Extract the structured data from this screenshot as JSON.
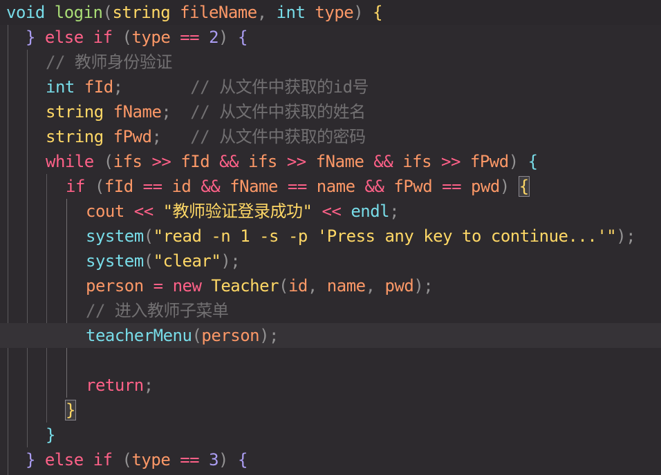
{
  "editor": {
    "theme": "dark",
    "colors": {
      "background": "#2d2a2e",
      "current_line": "#363337",
      "keyword": "#ff6188",
      "type": "#78dce8",
      "function": "#a9dc76",
      "string": "#ffd866",
      "parameter": "#fc9867",
      "number": "#ab9df2",
      "comment": "#727072"
    },
    "lines": [
      {
        "tokens": [
          {
            "t": "void",
            "c": "ty"
          },
          {
            "t": " ",
            "c": "va"
          },
          {
            "t": "login",
            "c": "fn"
          },
          {
            "t": "(",
            "c": "pu"
          },
          {
            "t": "string",
            "c": "tp"
          },
          {
            "t": " ",
            "c": "va"
          },
          {
            "t": "fileName",
            "c": "pa"
          },
          {
            "t": ", ",
            "c": "pu"
          },
          {
            "t": "int",
            "c": "ty"
          },
          {
            "t": " ",
            "c": "va"
          },
          {
            "t": "type",
            "c": "pa"
          },
          {
            "t": ") ",
            "c": "pu"
          },
          {
            "t": "{",
            "c": "br1"
          }
        ]
      },
      {
        "tokens": [
          {
            "t": "} ",
            "c": "br2"
          },
          {
            "t": "else",
            "c": "kw"
          },
          {
            "t": " ",
            "c": "va"
          },
          {
            "t": "if",
            "c": "kw"
          },
          {
            "t": " (",
            "c": "pu"
          },
          {
            "t": "type",
            "c": "pa"
          },
          {
            "t": " ",
            "c": "va"
          },
          {
            "t": "==",
            "c": "op"
          },
          {
            "t": " ",
            "c": "va"
          },
          {
            "t": "2",
            "c": "nu"
          },
          {
            "t": ") ",
            "c": "pu"
          },
          {
            "t": "{",
            "c": "br2"
          }
        ]
      },
      {
        "tokens": [
          {
            "t": "// 教师身份验证",
            "c": "cm"
          }
        ]
      },
      {
        "tokens": [
          {
            "t": "int",
            "c": "ty"
          },
          {
            "t": " ",
            "c": "va"
          },
          {
            "t": "fId",
            "c": "pa"
          },
          {
            "t": ";",
            "c": "pu"
          },
          {
            "t": "       ",
            "c": "va"
          },
          {
            "t": "// 从文件中获取的id号",
            "c": "cm"
          }
        ]
      },
      {
        "tokens": [
          {
            "t": "string",
            "c": "tp"
          },
          {
            "t": " ",
            "c": "va"
          },
          {
            "t": "fName",
            "c": "pa"
          },
          {
            "t": ";",
            "c": "pu"
          },
          {
            "t": "  ",
            "c": "va"
          },
          {
            "t": "// 从文件中获取的姓名",
            "c": "cm"
          }
        ]
      },
      {
        "tokens": [
          {
            "t": "string",
            "c": "tp"
          },
          {
            "t": " ",
            "c": "va"
          },
          {
            "t": "fPwd",
            "c": "pa"
          },
          {
            "t": ";",
            "c": "pu"
          },
          {
            "t": "   ",
            "c": "va"
          },
          {
            "t": "// 从文件中获取的密码",
            "c": "cm"
          }
        ]
      },
      {
        "tokens": [
          {
            "t": "while",
            "c": "kw"
          },
          {
            "t": " (",
            "c": "pu"
          },
          {
            "t": "ifs",
            "c": "pa"
          },
          {
            "t": " ",
            "c": "va"
          },
          {
            "t": ">>",
            "c": "op"
          },
          {
            "t": " ",
            "c": "va"
          },
          {
            "t": "fId",
            "c": "pa"
          },
          {
            "t": " ",
            "c": "va"
          },
          {
            "t": "&&",
            "c": "op"
          },
          {
            "t": " ",
            "c": "va"
          },
          {
            "t": "ifs",
            "c": "pa"
          },
          {
            "t": " ",
            "c": "va"
          },
          {
            "t": ">>",
            "c": "op"
          },
          {
            "t": " ",
            "c": "va"
          },
          {
            "t": "fName",
            "c": "pa"
          },
          {
            "t": " ",
            "c": "va"
          },
          {
            "t": "&&",
            "c": "op"
          },
          {
            "t": " ",
            "c": "va"
          },
          {
            "t": "ifs",
            "c": "pa"
          },
          {
            "t": " ",
            "c": "va"
          },
          {
            "t": ">>",
            "c": "op"
          },
          {
            "t": " ",
            "c": "va"
          },
          {
            "t": "fPwd",
            "c": "pa"
          },
          {
            "t": ") ",
            "c": "pu"
          },
          {
            "t": "{",
            "c": "br3"
          }
        ]
      },
      {
        "tokens": [
          {
            "t": "if",
            "c": "kw"
          },
          {
            "t": " (",
            "c": "pu"
          },
          {
            "t": "fId",
            "c": "pa"
          },
          {
            "t": " ",
            "c": "va"
          },
          {
            "t": "==",
            "c": "op"
          },
          {
            "t": " ",
            "c": "va"
          },
          {
            "t": "id",
            "c": "pa"
          },
          {
            "t": " ",
            "c": "va"
          },
          {
            "t": "&&",
            "c": "op"
          },
          {
            "t": " ",
            "c": "va"
          },
          {
            "t": "fName",
            "c": "pa"
          },
          {
            "t": " ",
            "c": "va"
          },
          {
            "t": "==",
            "c": "op"
          },
          {
            "t": " ",
            "c": "va"
          },
          {
            "t": "name",
            "c": "pa"
          },
          {
            "t": " ",
            "c": "va"
          },
          {
            "t": "&&",
            "c": "op"
          },
          {
            "t": " ",
            "c": "va"
          },
          {
            "t": "fPwd",
            "c": "pa"
          },
          {
            "t": " ",
            "c": "va"
          },
          {
            "t": "==",
            "c": "op"
          },
          {
            "t": " ",
            "c": "va"
          },
          {
            "t": "pwd",
            "c": "pa"
          },
          {
            "t": ") ",
            "c": "pu"
          },
          {
            "t": "{",
            "c": "br1",
            "match": true
          }
        ]
      },
      {
        "tokens": [
          {
            "t": "cout",
            "c": "pa"
          },
          {
            "t": " ",
            "c": "va"
          },
          {
            "t": "<<",
            "c": "op"
          },
          {
            "t": " ",
            "c": "va"
          },
          {
            "t": "\"教师验证登录成功\"",
            "c": "st"
          },
          {
            "t": " ",
            "c": "va"
          },
          {
            "t": "<<",
            "c": "op"
          },
          {
            "t": " ",
            "c": "va"
          },
          {
            "t": "endl",
            "c": "ty"
          },
          {
            "t": ";",
            "c": "pu"
          }
        ]
      },
      {
        "tokens": [
          {
            "t": "system",
            "c": "ty"
          },
          {
            "t": "(",
            "c": "pu"
          },
          {
            "t": "\"read -n 1 -s -p 'Press any key to continue...'\"",
            "c": "st"
          },
          {
            "t": ");",
            "c": "pu"
          }
        ]
      },
      {
        "tokens": [
          {
            "t": "system",
            "c": "ty"
          },
          {
            "t": "(",
            "c": "pu"
          },
          {
            "t": "\"clear\"",
            "c": "st"
          },
          {
            "t": ");",
            "c": "pu"
          }
        ]
      },
      {
        "tokens": [
          {
            "t": "person",
            "c": "pa"
          },
          {
            "t": " ",
            "c": "va"
          },
          {
            "t": "=",
            "c": "op"
          },
          {
            "t": " ",
            "c": "va"
          },
          {
            "t": "new",
            "c": "kw"
          },
          {
            "t": " ",
            "c": "va"
          },
          {
            "t": "Teacher",
            "c": "tp"
          },
          {
            "t": "(",
            "c": "pu"
          },
          {
            "t": "id",
            "c": "pa"
          },
          {
            "t": ", ",
            "c": "pu"
          },
          {
            "t": "name",
            "c": "pa"
          },
          {
            "t": ", ",
            "c": "pu"
          },
          {
            "t": "pwd",
            "c": "pa"
          },
          {
            "t": ");",
            "c": "pu"
          }
        ]
      },
      {
        "tokens": [
          {
            "t": "// 进入教师子菜单",
            "c": "cm"
          }
        ]
      },
      {
        "tokens": [
          {
            "t": "teacherMenu",
            "c": "ty"
          },
          {
            "t": "(",
            "c": "pu"
          },
          {
            "t": "person",
            "c": "pa"
          },
          {
            "t": ");",
            "c": "pu"
          }
        ]
      },
      {
        "tokens": []
      },
      {
        "tokens": [
          {
            "t": "return",
            "c": "kw"
          },
          {
            "t": ";",
            "c": "pu"
          }
        ]
      },
      {
        "tokens": [
          {
            "t": "}",
            "c": "br1",
            "match": true
          }
        ]
      },
      {
        "tokens": [
          {
            "t": "}",
            "c": "br3"
          }
        ]
      },
      {
        "tokens": [
          {
            "t": "} ",
            "c": "br2"
          },
          {
            "t": "else",
            "c": "kw"
          },
          {
            "t": " ",
            "c": "va"
          },
          {
            "t": "if",
            "c": "kw"
          },
          {
            "t": " (",
            "c": "pu"
          },
          {
            "t": "type",
            "c": "pa"
          },
          {
            "t": " ",
            "c": "va"
          },
          {
            "t": "==",
            "c": "op"
          },
          {
            "t": " ",
            "c": "va"
          },
          {
            "t": "3",
            "c": "nu"
          },
          {
            "t": ") ",
            "c": "pu"
          },
          {
            "t": "{",
            "c": "br2"
          }
        ]
      }
    ]
  }
}
